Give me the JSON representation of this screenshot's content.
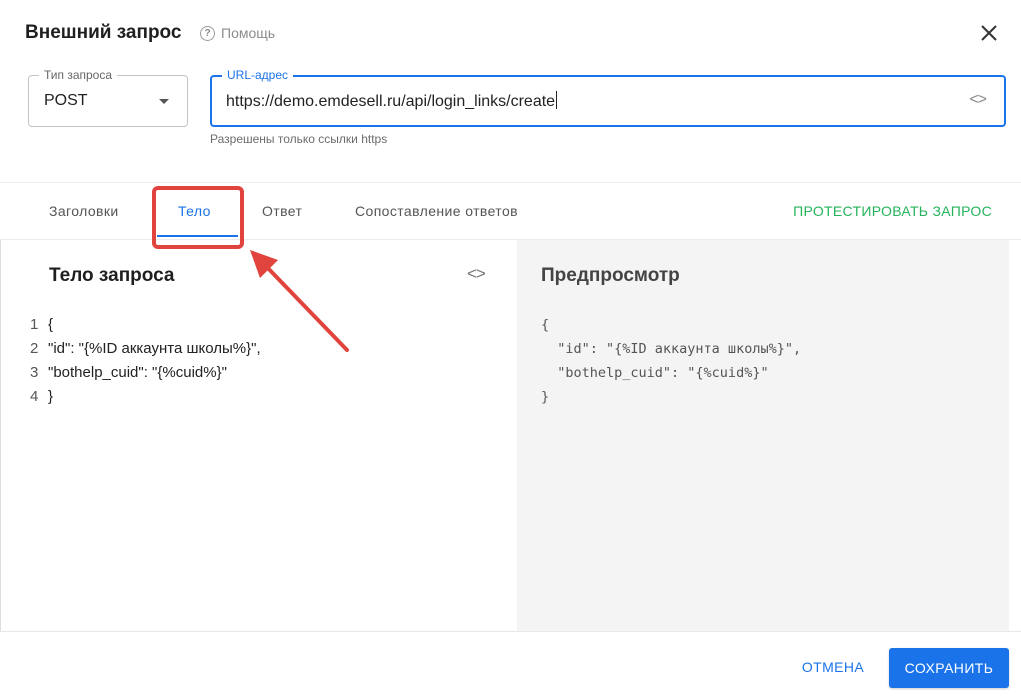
{
  "dialog": {
    "title": "Внешний запрос",
    "help_label": "Помощь",
    "help_icon": "?"
  },
  "request_type": {
    "label": "Тип запроса",
    "value": "POST"
  },
  "url_field": {
    "label": "URL-адрес",
    "value": "https://demo.emdesell.ru/api/login_links/create",
    "helper_text": "Разрешены только ссылки https",
    "code_icon": "<>"
  },
  "tabs": [
    {
      "label": "Заголовки",
      "active": false
    },
    {
      "label": "Тело",
      "active": true
    },
    {
      "label": "Ответ",
      "active": false
    },
    {
      "label": "Сопоставление ответов",
      "active": false
    }
  ],
  "test_button": "ПРОТЕСТИРОВАТЬ ЗАПРОС",
  "body_panel": {
    "title": "Тело запроса",
    "code_icon": "<>",
    "lines": [
      {
        "num": "1",
        "text": "{"
      },
      {
        "num": "2",
        "text": "\"id\": \"{%ID аккаунта школы%}\","
      },
      {
        "num": "3",
        "text": "\"bothelp_cuid\": \"{%cuid%}\""
      },
      {
        "num": "4",
        "text": "}"
      }
    ]
  },
  "preview_panel": {
    "title": "Предпросмотр",
    "lines": [
      "{",
      "  \"id\": \"{%ID аккаунта школы%}\",",
      "  \"bothelp_cuid\": \"{%cuid%}\"",
      "}"
    ]
  },
  "footer": {
    "cancel_label": "ОТМЕНА",
    "save_label": "СОХРАНИТЬ"
  },
  "colors": {
    "accent": "#1a73e8",
    "test": "#24b35a",
    "annotation": "#e0443c"
  }
}
